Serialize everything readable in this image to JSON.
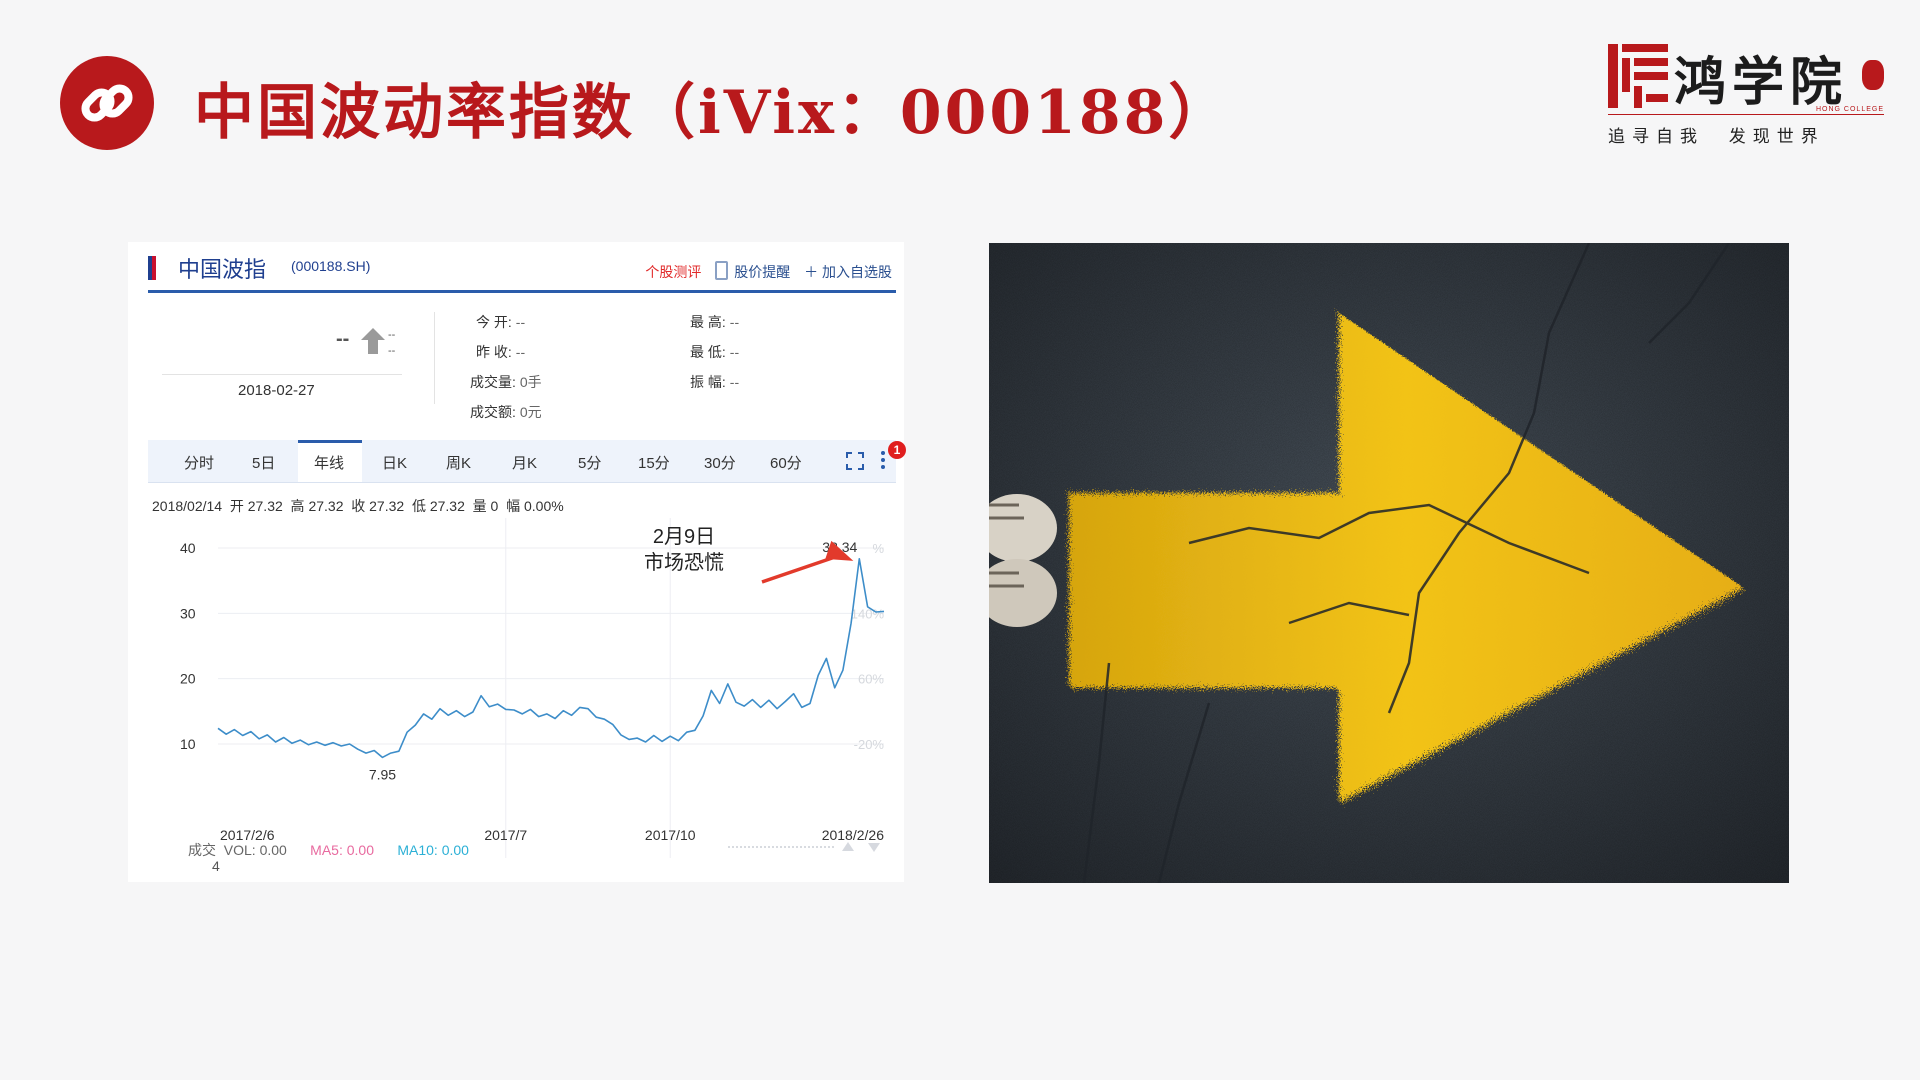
{
  "page": {
    "title": "中国波动率指数（iVix：000188）"
  },
  "logo": {
    "name": "鸿学院",
    "sub": "HONG COLLEGE",
    "slogan": "追寻自我  发现世界"
  },
  "stock_widget": {
    "name": "中国波指",
    "code": "(000188.SH)",
    "actions": [
      "个股测评",
      "股价提醒",
      "加入自选股"
    ],
    "price": "--",
    "change": "--",
    "change_pct": "--",
    "date": "2018-02-27",
    "quotes": {
      "open_label": "今 开:",
      "open": "--",
      "prev_close_label": "昨 收:",
      "prev_close": "--",
      "volume_label": "成交量:",
      "volume": "0手",
      "amount_label": "成交额:",
      "amount": "0元",
      "high_label": "最 高:",
      "high": "--",
      "low_label": "最 低:",
      "low": "--",
      "amplitude_label": "振 幅:",
      "amplitude": "--"
    },
    "tabs": [
      "分时",
      "5日",
      "年线",
      "日K",
      "周K",
      "月K",
      "5分",
      "15分",
      "30分",
      "60分"
    ],
    "active_tab": "年线",
    "badge": "1",
    "ohlc_line": "2018/02/14  开 27.32  高 27.32  收 27.32  低 27.32  量 0  幅 0.00%",
    "annotation": [
      "2月9日",
      "市场恐慌"
    ],
    "volume_line": {
      "label": "成交",
      "vol": "VOL: 0.00",
      "ma5": "MA5: 0.00",
      "ma10": "MA10: 0.00"
    },
    "volume_axis_value": "4",
    "colors": {
      "line": "#3d8dc9",
      "arrow": "#e23a2b",
      "accent": "#c8102e",
      "brand_blue": "#1f3f8f"
    }
  },
  "chart_data": {
    "type": "line",
    "title": "",
    "xlabel": "",
    "ylabel": "",
    "ylim": [
      6,
      40
    ],
    "yticks": [
      10,
      20,
      30,
      40
    ],
    "right_ticks": [
      "%",
      "140%",
      "60%",
      "-20%"
    ],
    "x_tick_labels": [
      "2017/2/6",
      "2017/7",
      "2017/10",
      "2018/2/26"
    ],
    "peak_label": "38.34",
    "min_label": "7.95",
    "grid": true,
    "series": [
      {
        "values": [
          12.4,
          11.5,
          12.2,
          11.3,
          11.9,
          10.8,
          11.4,
          10.3,
          11.0,
          10.1,
          10.6,
          9.9,
          10.3,
          9.8,
          10.2,
          9.7,
          10.0,
          9.2,
          8.6,
          9.0,
          7.95,
          8.6,
          8.9,
          11.8,
          12.9,
          14.6,
          13.8,
          15.4,
          14.4,
          15.1,
          14.2,
          14.9,
          17.4,
          15.7,
          16.1,
          15.3,
          15.2,
          14.6,
          15.3,
          14.2,
          14.6,
          13.9,
          15.1,
          14.4,
          15.6,
          15.4,
          14.1,
          13.8,
          13.0,
          11.4,
          10.7,
          10.9,
          10.3,
          11.3,
          10.4,
          11.2,
          10.5,
          11.8,
          12.1,
          14.3,
          18.2,
          16.2,
          19.2,
          16.4,
          15.8,
          16.8,
          15.6,
          16.7,
          15.4,
          16.5,
          17.7,
          15.6,
          16.2,
          20.5,
          23.1,
          18.6,
          21.3,
          28.5,
          38.34,
          31.0,
          30.2,
          30.3
        ]
      }
    ]
  },
  "photo": {
    "content": "yellow painted arrow on cracked asphalt"
  }
}
